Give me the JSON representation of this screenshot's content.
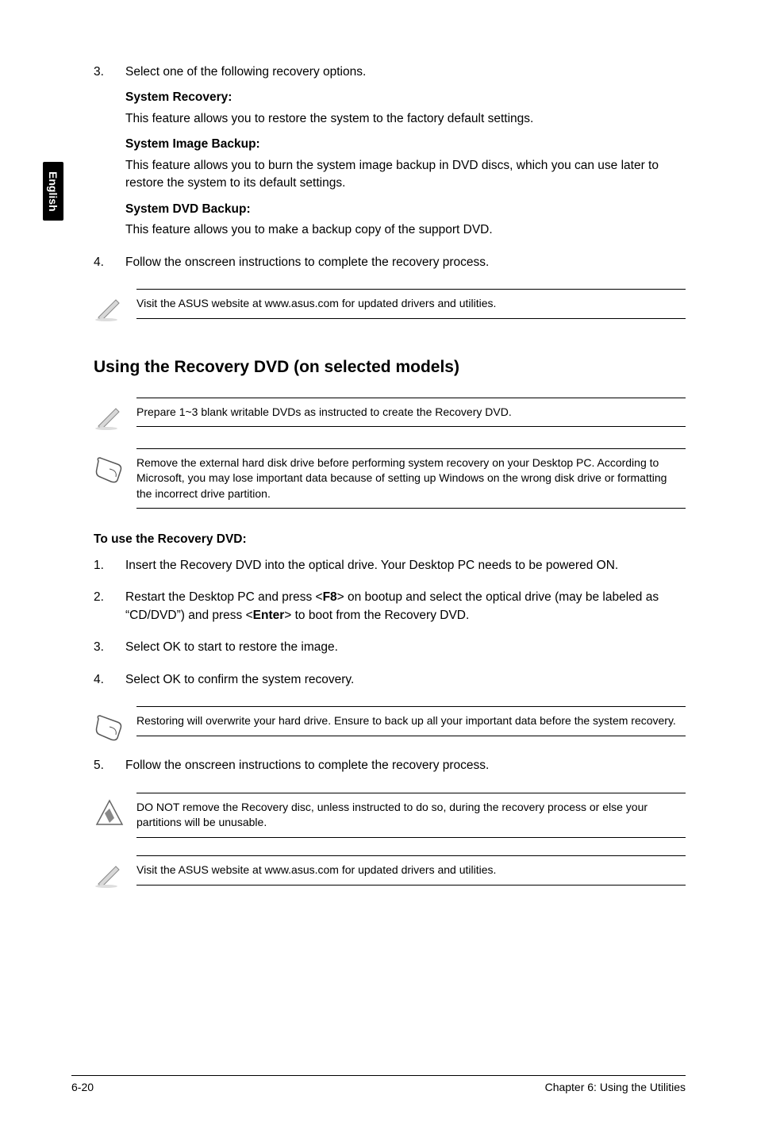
{
  "side_tab": "English",
  "s1": {
    "n3": "3.",
    "t3": "Select one of the following recovery options.",
    "opt1_t": "System Recovery:",
    "opt1_d": "This feature allows you to restore the system to the factory default settings.",
    "opt2_t": "System Image Backup:",
    "opt2_d": "This feature allows you to burn the system image backup in DVD discs, which you can use later to restore the system to its default settings.",
    "opt3_t": "System DVD Backup:",
    "opt3_d": "This feature allows you to make a backup copy of the support DVD.",
    "n4": "4.",
    "t4": "Follow the onscreen instructions to complete the recovery process."
  },
  "note1": "Visit the ASUS website at www.asus.com for updated drivers and utilities.",
  "h2": "Using the Recovery DVD (on selected models)",
  "note2": "Prepare 1~3 blank writable DVDs as instructed to create the Recovery DVD.",
  "note3": "Remove the external hard disk drive before performing system recovery on your Desktop PC. According to Microsoft, you may lose important data because of setting up Windows on the wrong disk drive or formatting the incorrect drive partition.",
  "sub_head": "To use the Recovery DVD:",
  "s2": {
    "n1": "1.",
    "t1": "Insert the Recovery DVD into the optical drive. Your Desktop PC needs to be powered ON.",
    "n2": "2.",
    "t2a": "Restart the Desktop PC and press <",
    "t2k1": "F8",
    "t2b": "> on bootup and select the optical drive (may be labeled as “CD/DVD”) and press <",
    "t2k2": "Enter",
    "t2c": "> to boot from the Recovery DVD.",
    "n3": "3.",
    "t3": "Select OK to start to restore the image.",
    "n4": "4.",
    "t4": "Select OK to confirm the system recovery."
  },
  "note4": "Restoring will overwrite your hard drive. Ensure to back up all your important data before the system recovery.",
  "s3": {
    "n5": "5.",
    "t5": "Follow the onscreen instructions to complete the recovery process."
  },
  "note5": "DO NOT remove the Recovery disc, unless instructed to do so, during the recovery process or else your partitions will be unusable.",
  "note6": "Visit the ASUS website at www.asus.com for updated drivers and utilities.",
  "footer_left": "6-20",
  "footer_right": "Chapter 6: Using the Utilities"
}
